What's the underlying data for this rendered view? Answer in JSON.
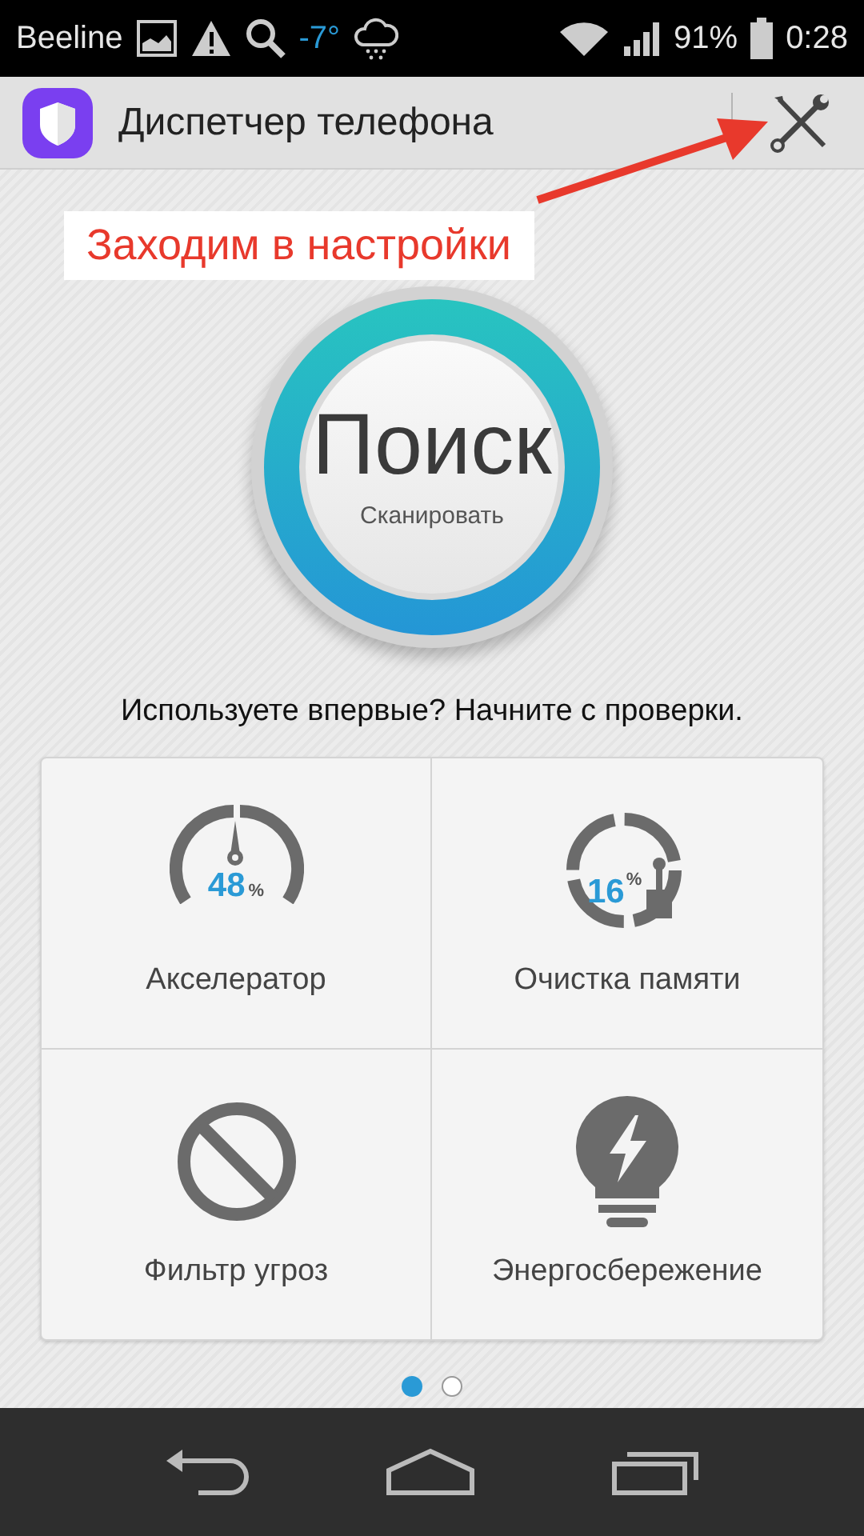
{
  "status_bar": {
    "carrier": "Beeline",
    "temperature": "-7°",
    "battery": "91%",
    "time": "0:28"
  },
  "header": {
    "title": "Диспетчер телефона"
  },
  "annotation": {
    "text": "Заходим в настройки"
  },
  "scan_button": {
    "title": "Поиск",
    "subtitle": "Сканировать"
  },
  "hint": "Используете впервые? Начните с проверки.",
  "tiles": [
    {
      "kind": "gauge",
      "value": "48",
      "unit": "%",
      "label": "Акселератор"
    },
    {
      "kind": "memory",
      "value": "16",
      "unit": "%",
      "label": "Очистка памяти"
    },
    {
      "kind": "filter",
      "label": "Фильтр угроз"
    },
    {
      "kind": "energy",
      "label": "Энергосбережение"
    }
  ],
  "pages": [
    {
      "selected": true
    },
    {
      "selected": false
    }
  ]
}
